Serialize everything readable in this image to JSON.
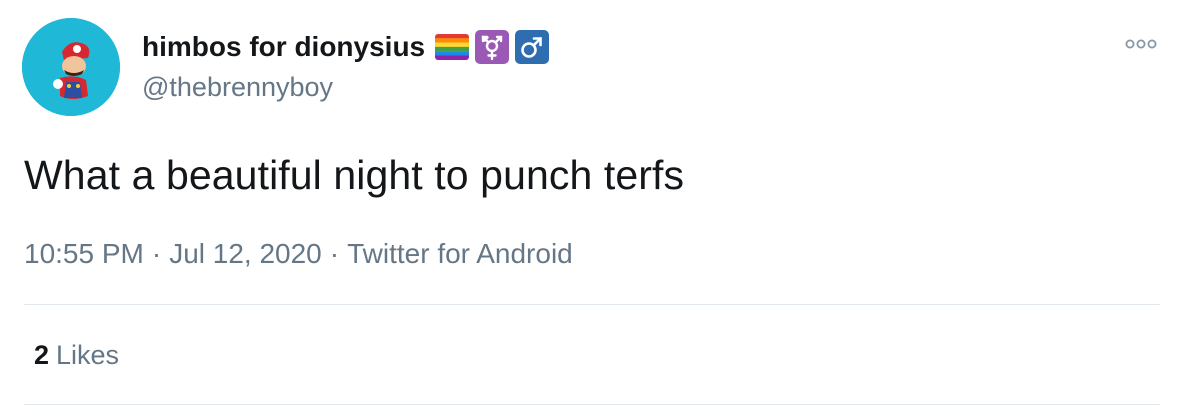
{
  "author": {
    "display_name": "himbos for dionysius",
    "handle": "@thebrennyboy",
    "name_emojis": [
      "rainbow-flag-icon",
      "transgender-symbol-icon",
      "male-sign-icon"
    ],
    "avatar": "avatar-mario-icon"
  },
  "tweet": {
    "text": "What a beautiful night to punch terfs",
    "time": "10:55 PM",
    "date": "Jul 12, 2020",
    "source": "Twitter for Android",
    "separator": "·"
  },
  "stats": {
    "likes_count": "2",
    "likes_label": "Likes"
  },
  "colors": {
    "primary_text": "#14171a",
    "secondary_text": "#657786",
    "divider": "#e1e8ed",
    "avatar_bg": "#1fb8d6",
    "trans_box": "#9b59b6",
    "male_box": "#2d6db0"
  }
}
